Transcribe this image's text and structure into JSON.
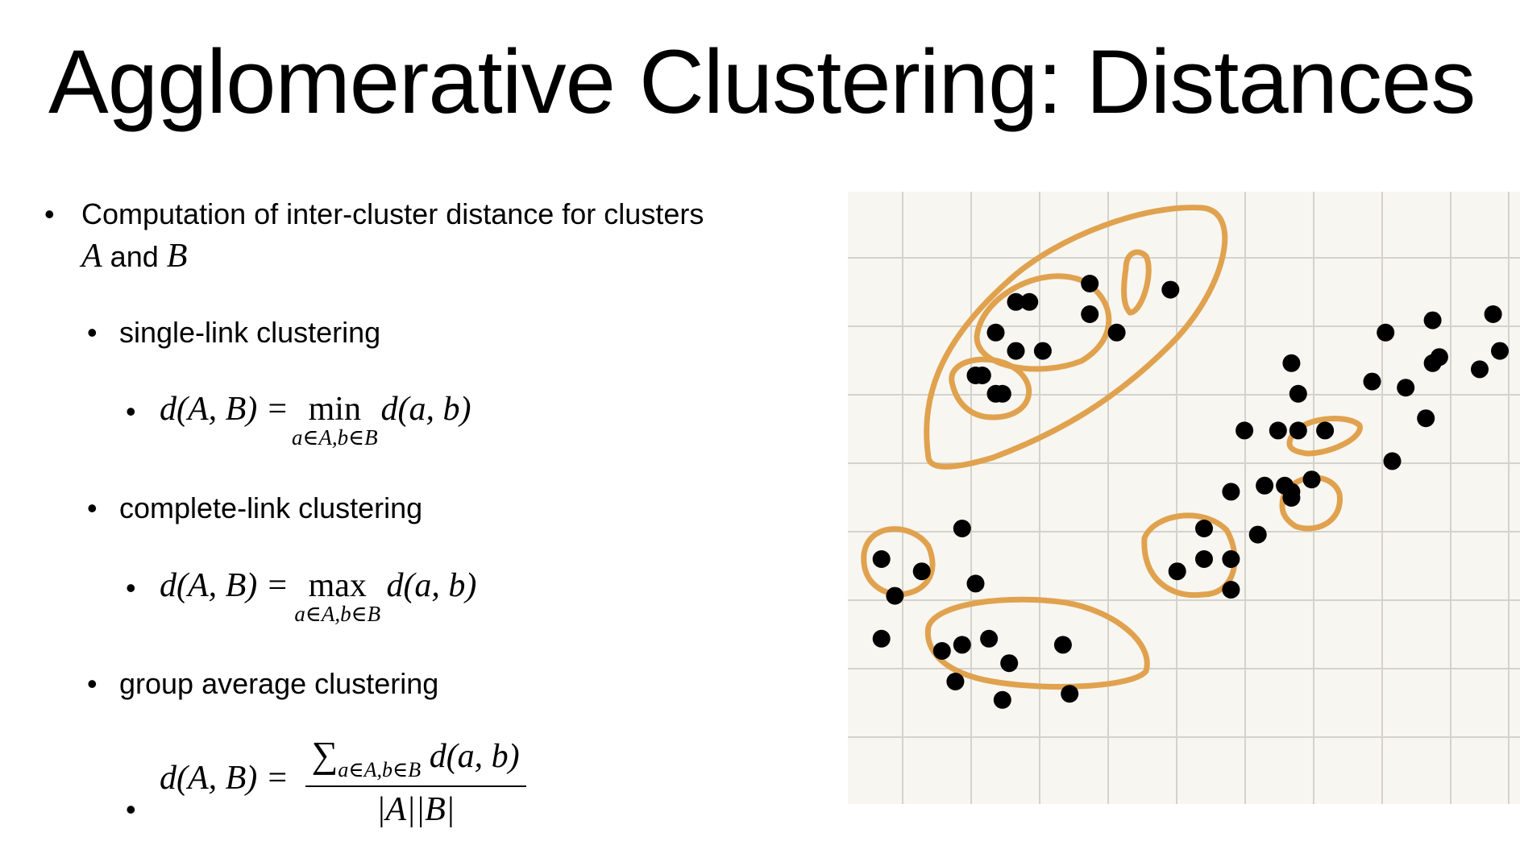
{
  "title": "Agglomerative Clustering: Distances",
  "intro": {
    "text": "Computation of inter-cluster distance for clusters",
    "var_a": "A",
    "and": "and",
    "var_b": "B"
  },
  "methods": [
    {
      "label": "single-link clustering",
      "lhs": "d(A, B) =",
      "op": "min",
      "op_sub": "a∈A,b∈B",
      "rhs": "d(a, b)"
    },
    {
      "label": "complete-link clustering",
      "lhs": "d(A, B) =",
      "op": "max",
      "op_sub": "a∈A,b∈B",
      "rhs": "d(a, b)"
    },
    {
      "label": "group average clustering",
      "lhs": "d(A, B) =",
      "num_sigma": "∑",
      "num_sub": "a∈A,b∈B",
      "num_rhs": "d(a, b)",
      "den": "|A||B|"
    }
  ],
  "figure": {
    "colors": {
      "paper": "#f8f6f1",
      "grid": "#d4d2cc",
      "point": "#000000",
      "circle": "#e0a24e"
    },
    "points": [
      [
        0.36,
        0.15
      ],
      [
        0.27,
        0.18
      ],
      [
        0.25,
        0.18
      ],
      [
        0.36,
        0.2
      ],
      [
        0.22,
        0.23
      ],
      [
        0.4,
        0.23
      ],
      [
        0.25,
        0.26
      ],
      [
        0.29,
        0.26
      ],
      [
        0.48,
        0.16
      ],
      [
        0.19,
        0.3
      ],
      [
        0.2,
        0.3
      ],
      [
        0.22,
        0.33
      ],
      [
        0.23,
        0.33
      ],
      [
        0.8,
        0.23
      ],
      [
        0.87,
        0.21
      ],
      [
        0.96,
        0.2
      ],
      [
        0.66,
        0.28
      ],
      [
        0.67,
        0.33
      ],
      [
        0.78,
        0.31
      ],
      [
        0.83,
        0.32
      ],
      [
        0.87,
        0.28
      ],
      [
        0.88,
        0.27
      ],
      [
        0.94,
        0.29
      ],
      [
        0.97,
        0.26
      ],
      [
        0.86,
        0.37
      ],
      [
        0.81,
        0.44
      ],
      [
        0.59,
        0.39
      ],
      [
        0.64,
        0.39
      ],
      [
        0.67,
        0.39
      ],
      [
        0.71,
        0.39
      ],
      [
        0.57,
        0.49
      ],
      [
        0.62,
        0.48
      ],
      [
        0.65,
        0.48
      ],
      [
        0.66,
        0.49
      ],
      [
        0.66,
        0.5
      ],
      [
        0.69,
        0.47
      ],
      [
        0.61,
        0.56
      ],
      [
        0.53,
        0.55
      ],
      [
        0.57,
        0.6
      ],
      [
        0.53,
        0.6
      ],
      [
        0.49,
        0.62
      ],
      [
        0.57,
        0.65
      ],
      [
        0.05,
        0.6
      ],
      [
        0.11,
        0.62
      ],
      [
        0.07,
        0.66
      ],
      [
        0.17,
        0.55
      ],
      [
        0.19,
        0.64
      ],
      [
        0.05,
        0.73
      ],
      [
        0.17,
        0.74
      ],
      [
        0.21,
        0.73
      ],
      [
        0.14,
        0.75
      ],
      [
        0.16,
        0.8
      ],
      [
        0.24,
        0.77
      ],
      [
        0.32,
        0.74
      ],
      [
        0.23,
        0.83
      ],
      [
        0.33,
        0.82
      ]
    ]
  }
}
